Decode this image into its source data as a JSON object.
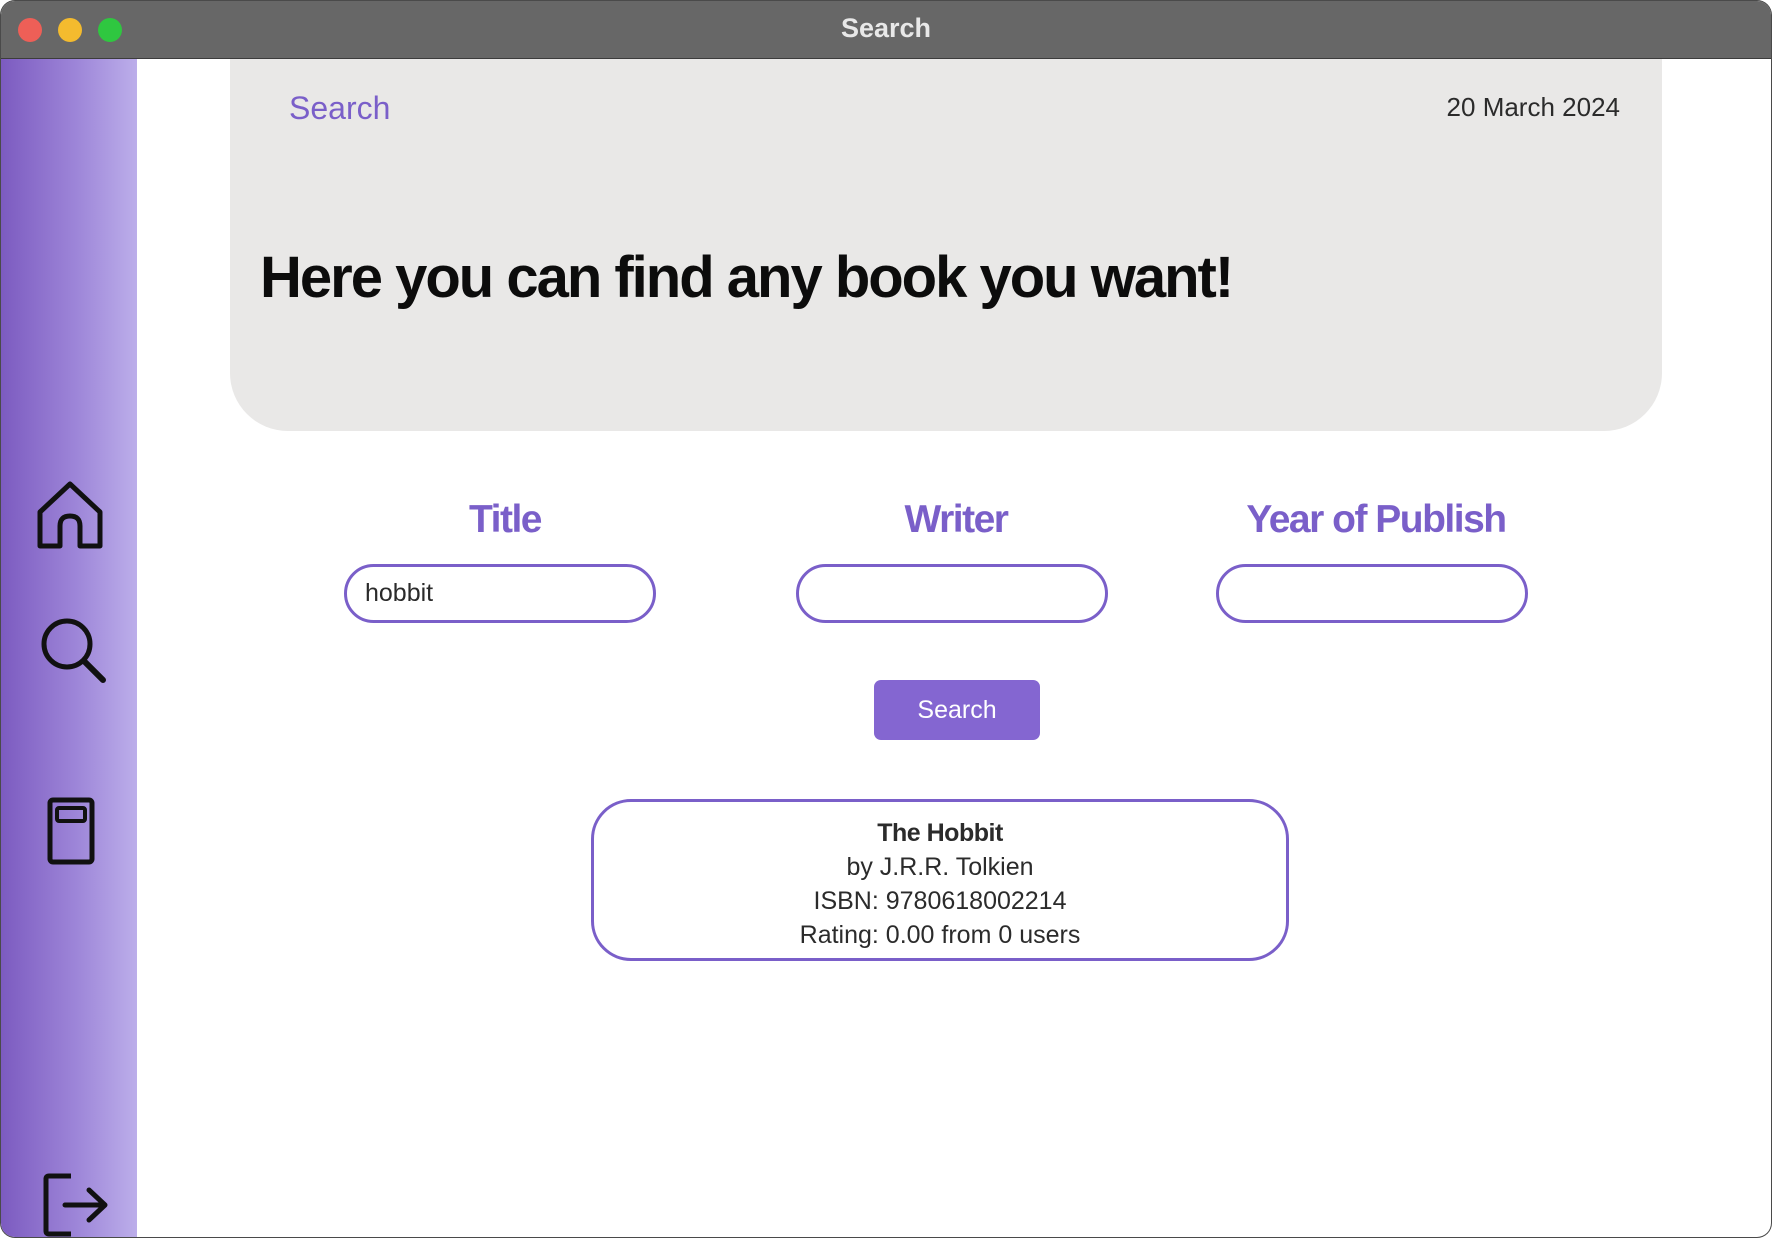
{
  "window": {
    "title": "Search"
  },
  "sidebar": {
    "items": [
      {
        "name": "home",
        "icon": "home-icon"
      },
      {
        "name": "search",
        "icon": "search-icon"
      },
      {
        "name": "library",
        "icon": "book-icon"
      }
    ],
    "logout": {
      "icon": "logout-icon"
    }
  },
  "header": {
    "breadcrumb": "Search",
    "date": "20 March 2024",
    "headline": "Here you can find any book you want!"
  },
  "form": {
    "title_label": "Title",
    "title_value": "hobbit",
    "writer_label": "Writer",
    "writer_value": "",
    "year_label": "Year of Publish",
    "year_value": "",
    "search_button": "Search"
  },
  "results": [
    {
      "title": "The Hobbit",
      "author": "by J.R.R. Tolkien",
      "isbn": "ISBN: 9780618002214",
      "rating": "Rating: 0.00 from 0 users"
    }
  ],
  "colors": {
    "accent": "#7a5fc9",
    "button": "#8466d1",
    "header_bg": "#e9e8e7",
    "titlebar": "#676767"
  }
}
